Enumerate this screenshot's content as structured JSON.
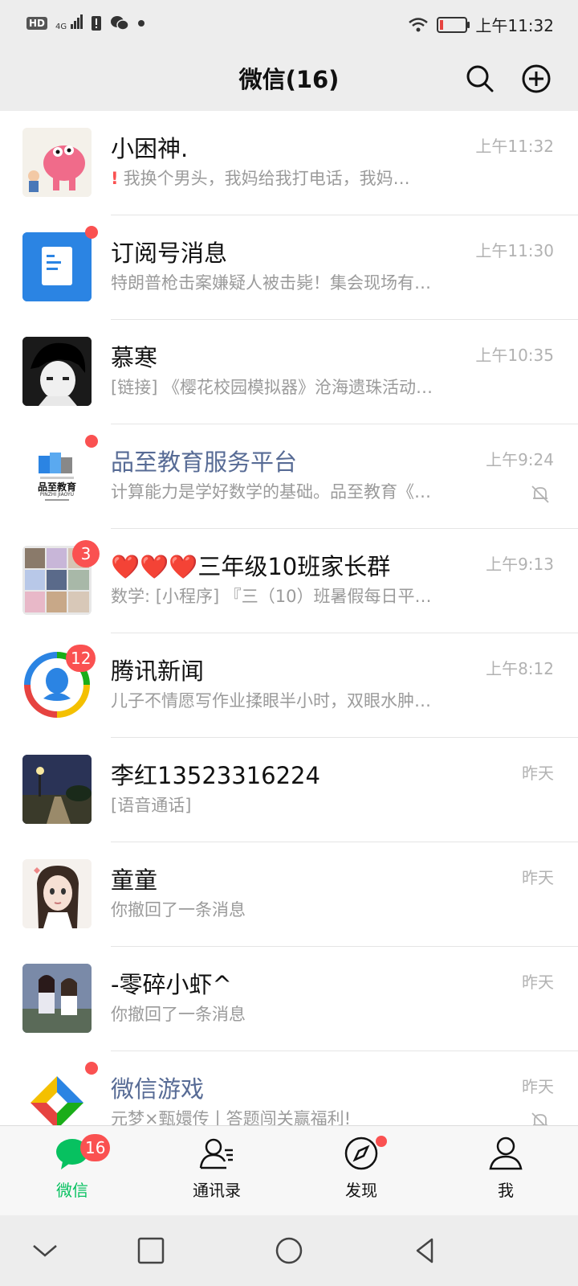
{
  "status_bar": {
    "hd": "HD",
    "network": "4G",
    "time": "上午11:32"
  },
  "header": {
    "title": "微信(16)"
  },
  "chats": [
    {
      "name": "小困神.",
      "preview": "我换个男头，我妈给我打电话，我妈…",
      "time": "上午11:32",
      "warn": true
    },
    {
      "name": "订阅号消息",
      "preview": "特朗普枪击案嫌疑人被击毙！集会现场有…",
      "time": "上午11:30"
    },
    {
      "name": "慕寒",
      "preview": "[链接] 《樱花校园模拟器》沧海遗珠活动…",
      "time": "上午10:35"
    },
    {
      "name": "品至教育服务平台",
      "preview": "计算能力是学好数学的基础。品至教育《…",
      "time": "上午9:24",
      "avatar_text": "品至教育",
      "avatar_sub": "PINZHI JIAOYU"
    },
    {
      "name": "❤️❤️❤️三年级10班家长群",
      "preview": "数学: [小程序] 『三（10）班暑假每日平…",
      "time": "上午9:13",
      "badge": "3"
    },
    {
      "name": "腾讯新闻",
      "preview": "儿子不情愿写作业揉眼半小时，双眼水肿…",
      "time": "上午8:12",
      "badge": "12"
    },
    {
      "name": "李红13523316224",
      "preview": "[语音通话]",
      "time": "昨天"
    },
    {
      "name": "童童",
      "preview": "你撤回了一条消息",
      "time": "昨天"
    },
    {
      "name": "-零碎小虾^",
      "preview": "你撤回了一条消息",
      "time": "昨天"
    },
    {
      "name": "微信游戏",
      "preview": "元梦×甄嬛传丨答题闯关赢福利!",
      "time": "昨天"
    }
  ],
  "tabs": [
    {
      "label": "微信",
      "badge": "16"
    },
    {
      "label": "通讯录"
    },
    {
      "label": "发现"
    },
    {
      "label": "我"
    }
  ],
  "colors": {
    "accent": "#07c160",
    "badge": "#fa5151",
    "official_name": "#576b95"
  },
  "icons": [
    "search-icon",
    "add-circle-icon",
    "mute-bell-icon",
    "chat-bubble-icon",
    "contacts-icon",
    "compass-icon",
    "person-icon",
    "nav-back-icon",
    "nav-home-icon",
    "nav-recent-icon",
    "nav-collapse-icon"
  ]
}
